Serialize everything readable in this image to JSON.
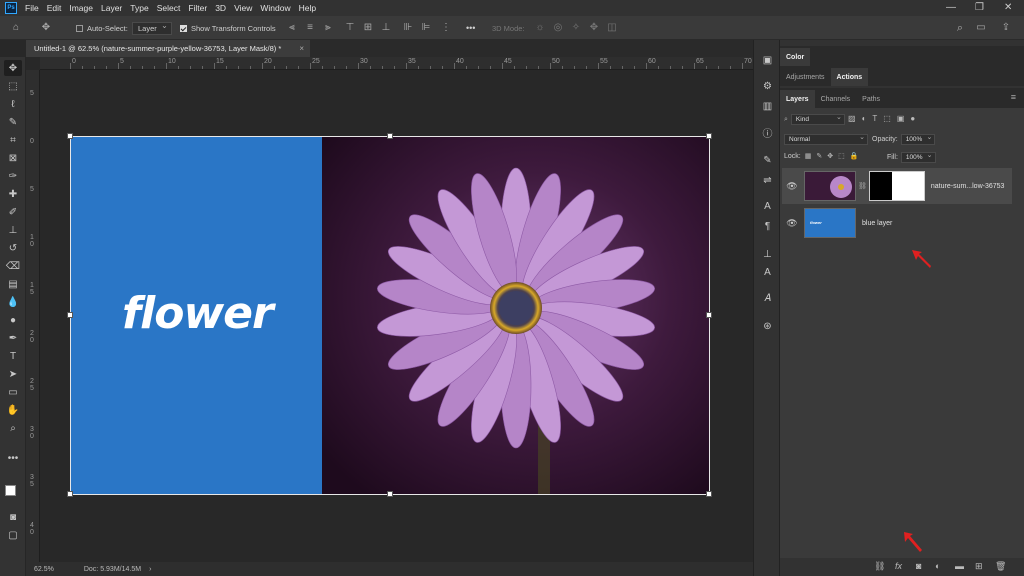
{
  "app": {
    "logo": "Ps"
  },
  "menu": [
    "File",
    "Edit",
    "Image",
    "Layer",
    "Type",
    "Select",
    "Filter",
    "3D",
    "View",
    "Window",
    "Help"
  ],
  "window_controls": {
    "minimize": "—",
    "restore": "❐",
    "close": "✕"
  },
  "options_bar": {
    "auto_select_label": "Auto-Select:",
    "auto_select_value": "Layer",
    "show_transform_label": "Show Transform Controls",
    "mode_3d_label": "3D Mode:",
    "more_label": "•••"
  },
  "document_tab": {
    "title": "Untitled-1 @ 62.5% (nature-summer-purple-yellow-36753, Layer Mask/8) *",
    "close": "×"
  },
  "ruler_top": [
    "0",
    "5",
    "10",
    "15",
    "20",
    "25",
    "30",
    "35",
    "40",
    "45",
    "50",
    "55",
    "60",
    "65",
    "70"
  ],
  "ruler_left": [
    "5",
    "0",
    "5",
    "1\n0",
    "1\n5",
    "2\n0",
    "2\n5",
    "3\n0",
    "3\n5",
    "4\n0"
  ],
  "canvas": {
    "text": "flower",
    "blue_color": "#2a76c6"
  },
  "status_bar": {
    "zoom": "62.5%",
    "doc": "Doc: 5.93M/14.5M",
    "arrow": "›"
  },
  "panels": {
    "color_tab": "Color",
    "adjustments_tab": "Adjustments",
    "actions_tab": "Actions",
    "layers_tab": "Layers",
    "channels_tab": "Channels",
    "paths_tab": "Paths",
    "kind_filter": "Kind",
    "blend_mode": "Normal",
    "opacity_label": "Opacity:",
    "opacity_value": "100%",
    "lock_label": "Lock:",
    "fill_label": "Fill:",
    "fill_value": "100%"
  },
  "layers": [
    {
      "name": "nature-sum...low-36753",
      "visible": true,
      "selected": true
    },
    {
      "name": "blue layer",
      "visible": true,
      "selected": false,
      "thumb_text": "flower"
    }
  ],
  "footer_icons": [
    "link-icon",
    "fx-icon",
    "add-mask-icon",
    "adjustment-icon",
    "folder-icon",
    "new-layer-icon",
    "trash-icon"
  ],
  "footer_labels": {
    "fx": "fx"
  },
  "colors": {
    "accent": "#31a8ff",
    "annotation_red": "#e02020"
  }
}
